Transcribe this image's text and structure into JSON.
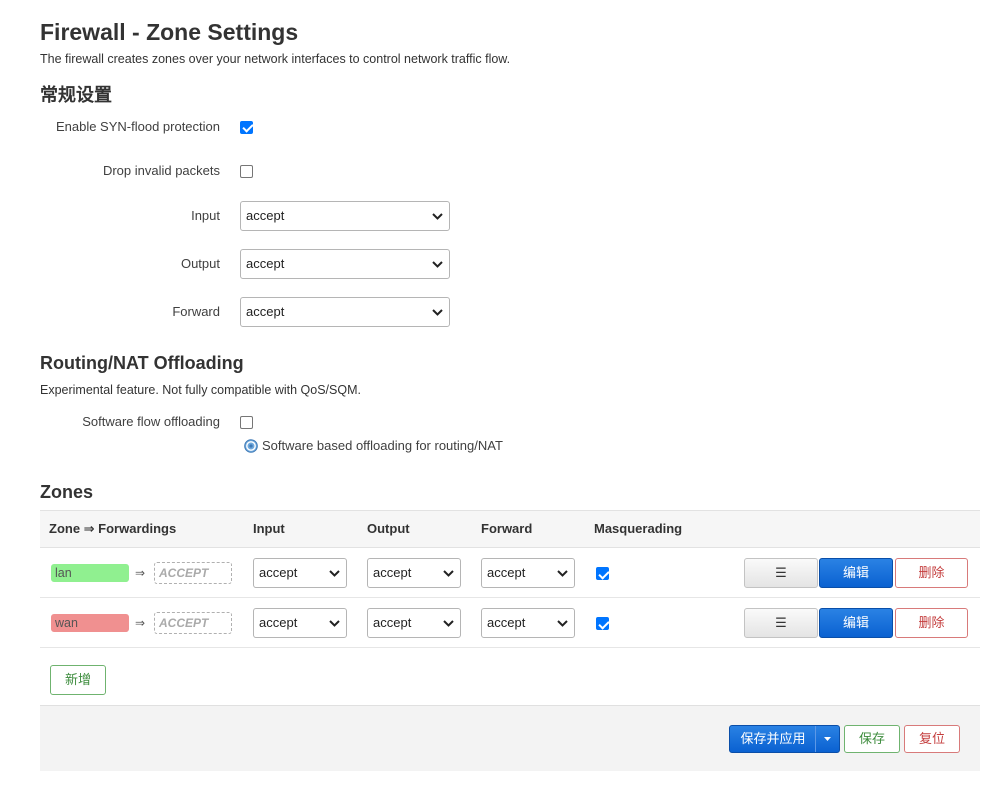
{
  "page": {
    "title": "Firewall - Zone Settings",
    "description": "The firewall creates zones over your network interfaces to control network traffic flow."
  },
  "general": {
    "title": "常规设置",
    "syn_flood": {
      "label": "Enable SYN-flood protection",
      "checked": true
    },
    "drop_invalid": {
      "label": "Drop invalid packets",
      "checked": false
    },
    "input": {
      "label": "Input",
      "value": "accept"
    },
    "output": {
      "label": "Output",
      "value": "accept"
    },
    "forward": {
      "label": "Forward",
      "value": "accept"
    }
  },
  "offloading": {
    "title": "Routing/NAT Offloading",
    "description": "Experimental feature. Not fully compatible with QoS/SQM.",
    "software_flow": {
      "label": "Software flow offloading",
      "checked": false
    },
    "hint": "Software based offloading for routing/NAT",
    "hint_icon": "help-circle-icon"
  },
  "zones": {
    "title": "Zones",
    "columns": {
      "zone": "Zone ⇒ Forwardings",
      "input": "Input",
      "output": "Output",
      "forward": "Forward",
      "masquerading": "Masquerading"
    },
    "rows": [
      {
        "name": "lan",
        "color": "#90f090",
        "arrow": "⇒",
        "forwarding": "ACCEPT",
        "input": "accept",
        "output": "accept",
        "forward": "accept",
        "masquerading": true,
        "menu_label": "☰",
        "edit_label": "编辑",
        "delete_label": "删除"
      },
      {
        "name": "wan",
        "color": "#f09090",
        "arrow": "⇒",
        "forwarding": "ACCEPT",
        "input": "accept",
        "output": "accept",
        "forward": "accept",
        "masquerading": true,
        "menu_label": "☰",
        "edit_label": "编辑",
        "delete_label": "删除"
      }
    ],
    "add_label": "新增"
  },
  "footer": {
    "save_apply_label": "保存并应用",
    "save_label": "保存",
    "reset_label": "复位"
  },
  "colors": {
    "primary": "#0a61d1",
    "positive": "#3d8c3d",
    "negative": "#c43d3d",
    "checkbox": "#0075ff"
  }
}
